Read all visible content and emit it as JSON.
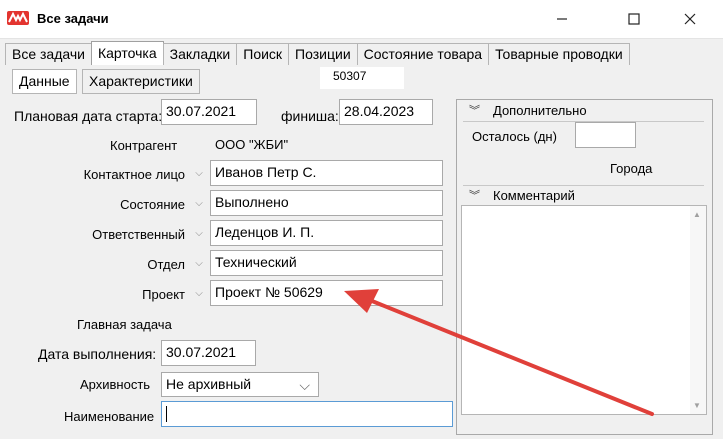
{
  "window": {
    "title": "Все задачи"
  },
  "tabs": [
    "Все задачи",
    "Карточка",
    "Закладки",
    "Поиск",
    "Позиции",
    "Состояние товара",
    "Товарные проводки"
  ],
  "active_tab": "Карточка",
  "subtabs": [
    "Данные",
    "Характеристики"
  ],
  "active_subtab": "Данные",
  "floating_number": "50307",
  "form": {
    "start_date_label": "Плановая дата старта:",
    "start_date": "30.07.2021",
    "finish_label": "финиша:",
    "finish_date": "28.04.2023",
    "contractor_label": "Контрагент",
    "contractor": "ООО \"ЖБИ\"",
    "contact_label": "Контактное лицо",
    "contact": "Иванов Петр С.",
    "state_label": "Состояние",
    "state": "Выполнено",
    "responsible_label": "Ответственный",
    "responsible": "Леденцов И. П.",
    "department_label": "Отдел",
    "department": "Технический",
    "project_label": "Проект",
    "project": "Проект № 50629",
    "main_task_label": "Главная задача",
    "done_date_label": "Дата выполнения:",
    "done_date": "30.07.2021",
    "archive_label": "Архивность",
    "archive": "Не архивный",
    "name_label": "Наименование",
    "name": ""
  },
  "right_panel": {
    "additional_header": "Дополнительно",
    "remaining_label": "Осталось (дн)",
    "remaining": "",
    "cities_label": "Города",
    "comment_header": "Комментарий"
  },
  "colors": {
    "arrow": "#e0403a",
    "logo": "#e3342f"
  },
  "icons": {
    "minimize": "minimize-icon",
    "maximize": "maximize-icon",
    "close": "close-icon"
  }
}
